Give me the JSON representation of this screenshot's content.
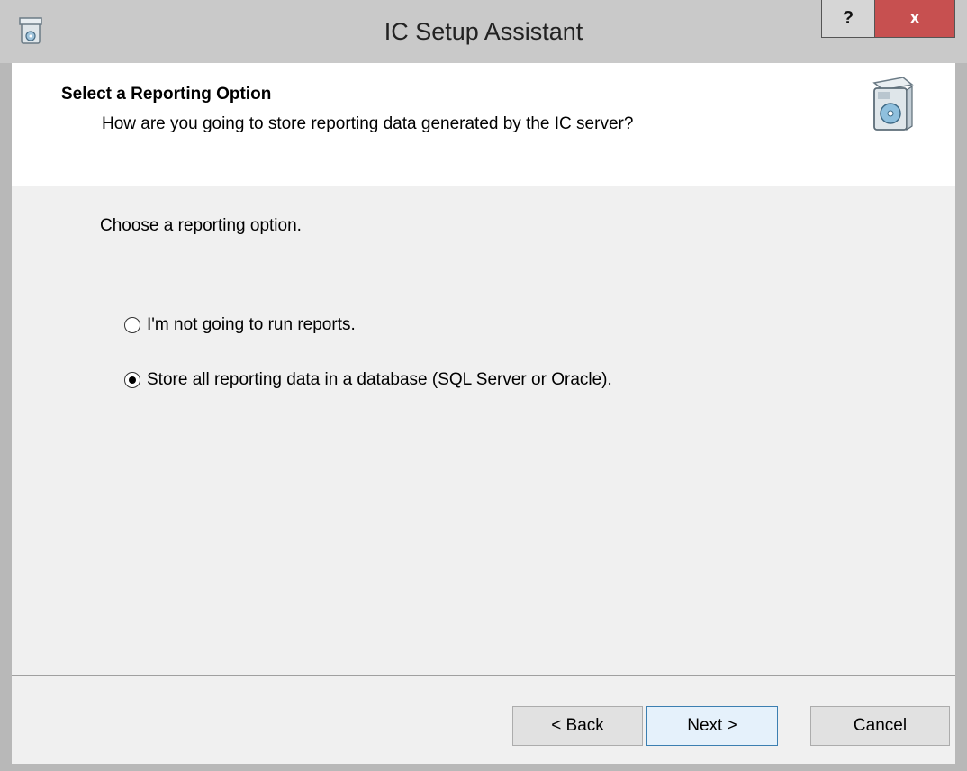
{
  "window": {
    "title": "IC Setup Assistant",
    "help_label": "?",
    "close_label": "x"
  },
  "header": {
    "title": "Select a Reporting Option",
    "subtitle": "How are you going to store reporting data generated by the IC server?"
  },
  "body": {
    "intro": "Choose a reporting option.",
    "options": [
      {
        "label": "I'm not going to run reports.",
        "selected": false
      },
      {
        "label": "Store all reporting data in a database (SQL Server or Oracle).",
        "selected": true
      }
    ]
  },
  "footer": {
    "back_label": "< Back",
    "next_label": "Next >",
    "cancel_label": "Cancel"
  },
  "colors": {
    "close_button": "#c75050",
    "default_button_border": "#3c7fb1"
  },
  "icons": [
    "setup-app-icon",
    "setup-package-icon"
  ]
}
